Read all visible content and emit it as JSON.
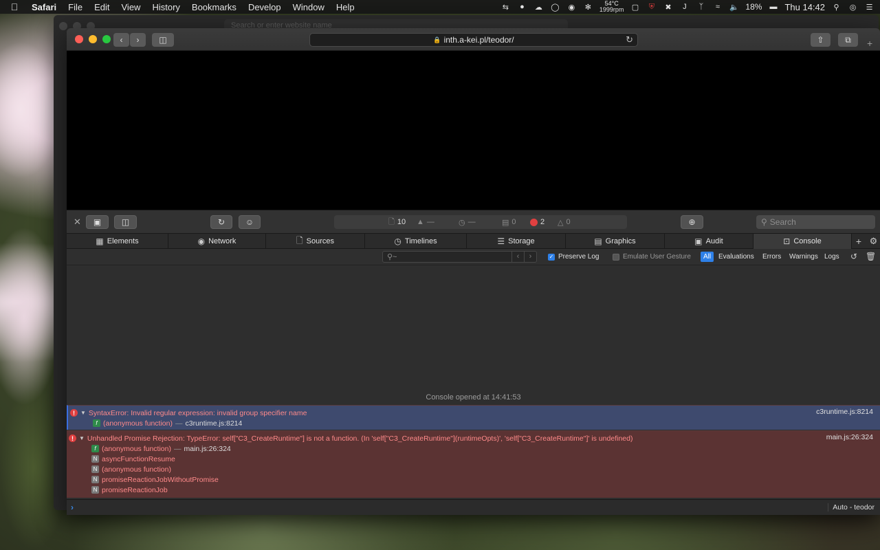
{
  "menubar": {
    "apple": "",
    "app_name": "Safari",
    "menus": [
      "File",
      "Edit",
      "View",
      "History",
      "Bookmarks",
      "Develop",
      "Window",
      "Help"
    ],
    "temp": "54°C",
    "rpm": "1999rpm",
    "battery": "18%",
    "clock": "Thu 14:42"
  },
  "bg_window": {
    "url_placeholder": "Search or enter website name"
  },
  "browser": {
    "url": "inth.a-kei.pl/teodor/"
  },
  "inspector": {
    "activity": {
      "resources": "10",
      "dash1": "—",
      "dash2": "—",
      "logs": "0",
      "errors": "2",
      "warnings": "0"
    },
    "search_placeholder": "Search",
    "tabs": [
      "Elements",
      "Network",
      "Sources",
      "Timelines",
      "Storage",
      "Graphics",
      "Audit",
      "Console"
    ],
    "filter": {
      "preserve_log": "Preserve Log",
      "emulate": "Emulate User Gesture",
      "levels": [
        "All",
        "Evaluations",
        "Errors",
        "Warnings",
        "Logs"
      ]
    },
    "console_opened": "Console opened at 14:41:53",
    "messages": [
      {
        "text": "SyntaxError: Invalid regular expression: invalid group specifier name",
        "location": "c3runtime.js:8214",
        "frames": [
          {
            "badge": "f",
            "name": "(anonymous function)",
            "sep": "—",
            "loc": "c3runtime.js:8214"
          }
        ]
      },
      {
        "text": "Unhandled Promise Rejection: TypeError: self[\"C3_CreateRuntime\"] is not a function. (In 'self[\"C3_CreateRuntime\"](runtimeOpts)', 'self[\"C3_CreateRuntime\"]' is undefined)",
        "location": "main.js:26:324",
        "frames": [
          {
            "badge": "f",
            "name": "(anonymous function)",
            "sep": "—",
            "loc": "main.js:26:324"
          },
          {
            "badge": "N",
            "name": "asyncFunctionResume"
          },
          {
            "badge": "N",
            "name": "(anonymous function)"
          },
          {
            "badge": "N",
            "name": "promiseReactionJobWithoutPromise"
          },
          {
            "badge": "N",
            "name": "promiseReactionJob"
          }
        ]
      }
    ],
    "context": "Auto - teodor"
  }
}
